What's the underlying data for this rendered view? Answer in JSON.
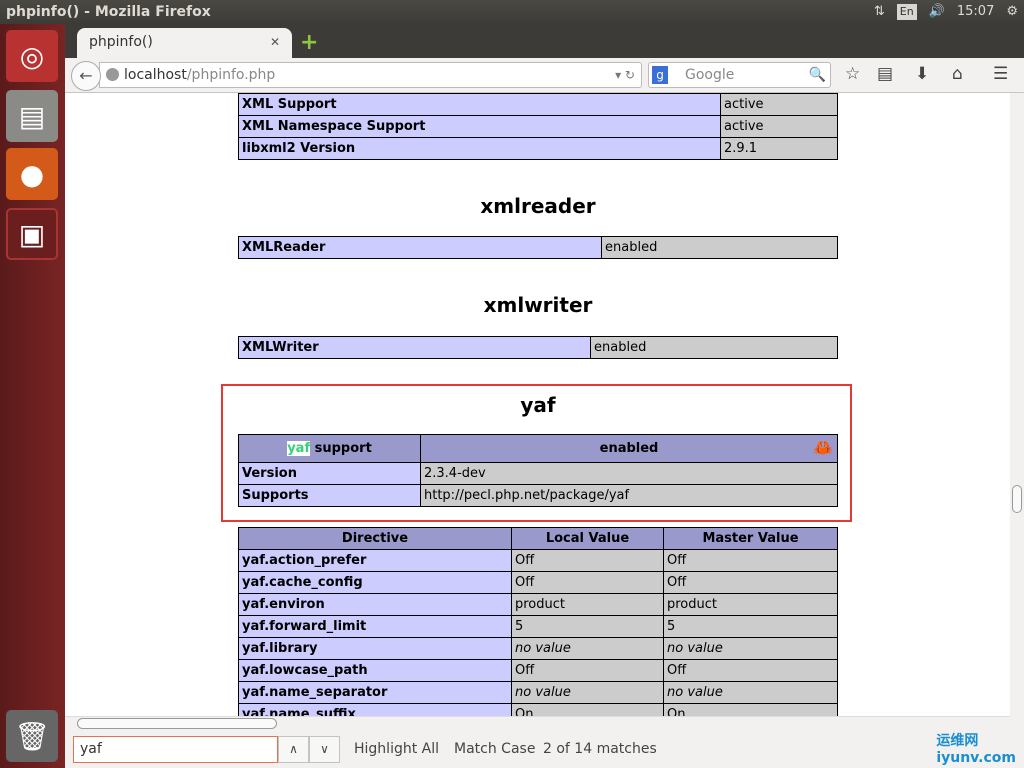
{
  "window": {
    "title": "phpinfo() - Mozilla Firefox",
    "time": "15:07",
    "lang": "En"
  },
  "tab": {
    "title": "phpinfo()"
  },
  "nav": {
    "url_host": "localhost",
    "url_path": "/phpinfo.php",
    "search_placeholder": "Google"
  },
  "page": {
    "xml_rows": [
      [
        "XML Support",
        "active"
      ],
      [
        "XML Namespace Support",
        "active"
      ],
      [
        "libxml2 Version",
        "2.9.1"
      ]
    ],
    "xmlreader": {
      "title": "xmlreader",
      "row": [
        "XMLReader",
        "enabled"
      ]
    },
    "xmlwriter": {
      "title": "xmlwriter",
      "row": [
        "XMLWriter",
        "enabled"
      ]
    },
    "yaf": {
      "title": "yaf",
      "support_hl": "yaf",
      "support_rest": " support",
      "support_val": "enabled",
      "rows": [
        [
          "Version",
          "2.3.4-dev"
        ],
        [
          "Supports",
          "http://pecl.php.net/package/yaf"
        ]
      ]
    },
    "directives": {
      "headers": [
        "Directive",
        "Local Value",
        "Master Value"
      ],
      "rows": [
        [
          "yaf.action_prefer",
          "Off",
          "Off"
        ],
        [
          "yaf.cache_config",
          "Off",
          "Off"
        ],
        [
          "yaf.environ",
          "product",
          "product"
        ],
        [
          "yaf.forward_limit",
          "5",
          "5"
        ],
        [
          "yaf.library",
          "no value",
          "no value"
        ],
        [
          "yaf.lowcase_path",
          "Off",
          "Off"
        ],
        [
          "yaf.name_separator",
          "no value",
          "no value"
        ],
        [
          "yaf.name_suffix",
          "On",
          "On"
        ]
      ]
    }
  },
  "findbar": {
    "query": "yaf",
    "highlight_all": "Highlight All",
    "match_case": "Match Case",
    "status": "2 of 14 matches"
  },
  "watermark": {
    "line1": "运维网",
    "line2": "iyunv.com"
  }
}
